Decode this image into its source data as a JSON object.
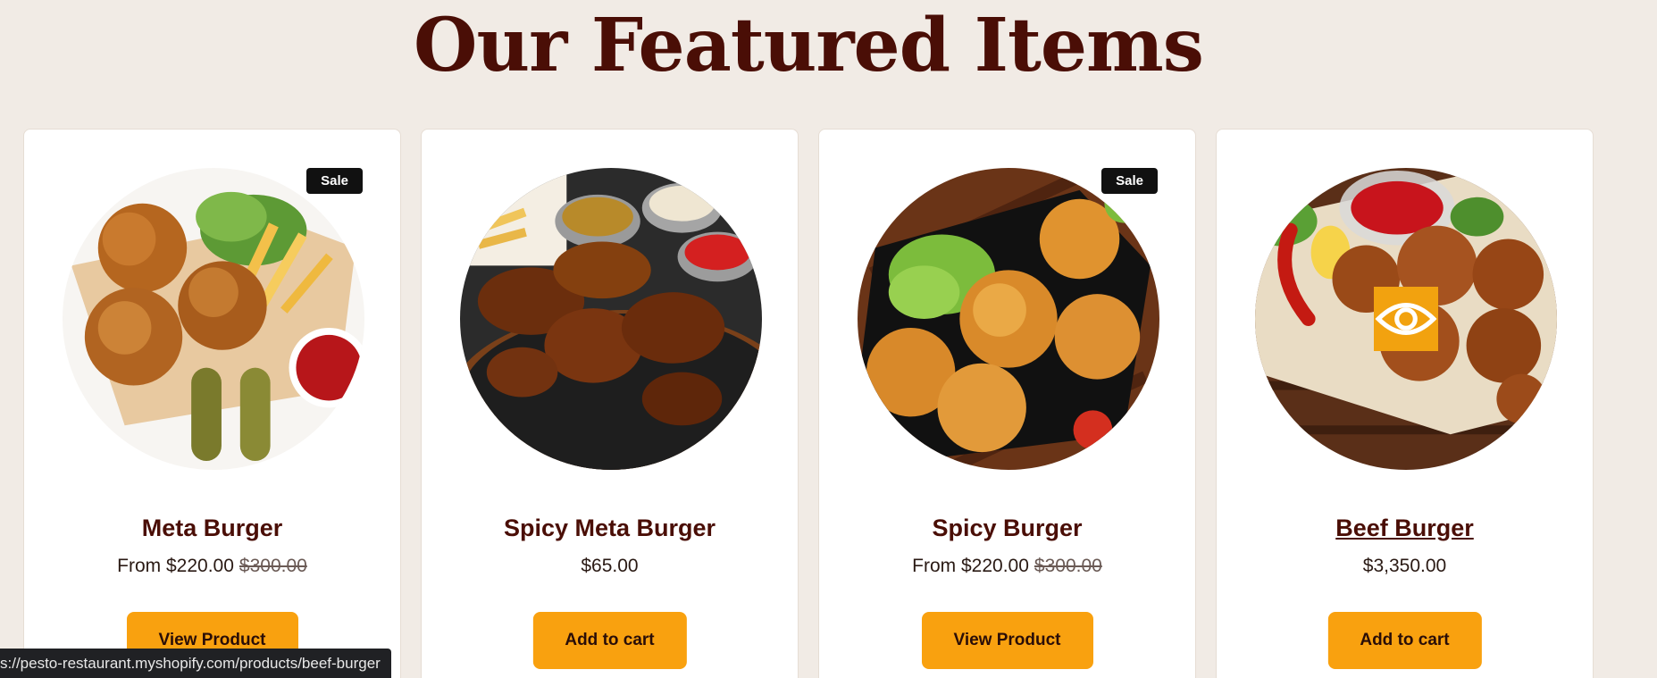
{
  "section": {
    "title": "Our Featured Items"
  },
  "products": [
    {
      "name": "Meta Burger",
      "price": "From $220.00",
      "compare_price": "$300.00",
      "badge": "Sale",
      "button": "View Product"
    },
    {
      "name": "Spicy Meta Burger",
      "price": "$65.00",
      "compare_price": "",
      "badge": "",
      "button": "Add to cart"
    },
    {
      "name": "Spicy Burger",
      "price": "From $220.00",
      "compare_price": "$300.00",
      "badge": "Sale",
      "button": "View Product"
    },
    {
      "name": "Beef Burger",
      "price": "$3,350.00",
      "compare_price": "",
      "badge": "",
      "button": "Add to cart"
    }
  ],
  "status_bar": {
    "url": "s://pesto-restaurant.myshopify.com/products/beef-burger"
  },
  "colors": {
    "background": "#f1ebe5",
    "title": "#4a0e06",
    "button": "#f9a10f",
    "badge": "#111111"
  },
  "icons": {
    "quick_view": "eye-icon"
  }
}
